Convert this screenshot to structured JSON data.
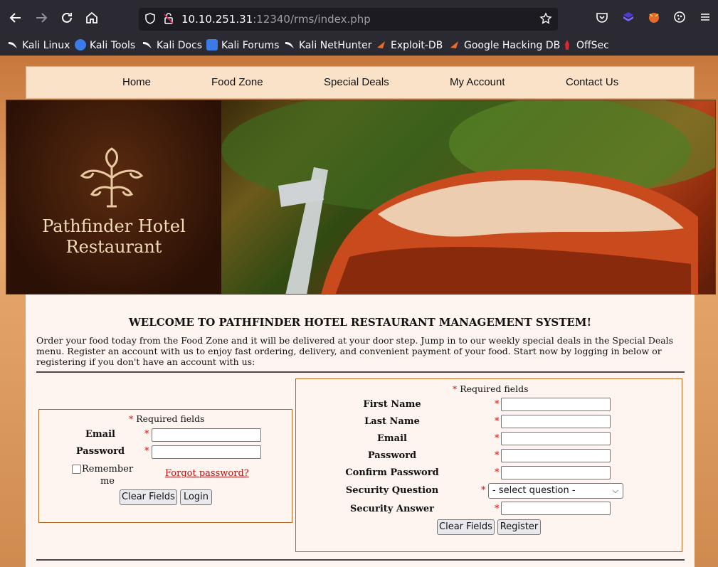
{
  "browser": {
    "url_host": "10.10.251.31",
    "url_rest": ":12340/rms/index.php",
    "icons": [
      "back-icon",
      "forward-icon",
      "reload-icon",
      "home-icon",
      "shield-icon",
      "lock-icon",
      "star-icon",
      "pocket-icon",
      "extension-icon",
      "profile-icon",
      "menu-icon"
    ],
    "bookmarks": [
      "Kali Linux",
      "Kali Tools",
      "Kali Docs",
      "Kali Forums",
      "Kali NetHunter",
      "Exploit-DB",
      "Google Hacking DB",
      "OffSec"
    ]
  },
  "menu": [
    "Home",
    "Food Zone",
    "Special Deals",
    "My Account",
    "Contact Us"
  ],
  "banner": {
    "name_line1": "Pathfinder Hotel",
    "name_line2": "Restaurant"
  },
  "main": {
    "welcome": "WELCOME TO PATHFINDER HOTEL RESTAURANT MANAGEMENT SYSTEM!",
    "intro": "Order your food today from the Food Zone and it will be delivered at your door step. Jump in to our weekly special deals in the Special Deals menu. Register an account with us to enjoy fast ordering, delivery, and convenient payment of your food. Start now by logging in below or registering if you don't have an account with us:"
  },
  "login": {
    "required": "Required fields",
    "email_label": "Email",
    "password_label": "Password",
    "remember_label": "Remember me",
    "forgot_label": "Forgot password?",
    "clear_label": "Clear Fields",
    "login_label": "Login"
  },
  "register": {
    "required": "Required fields",
    "first_name_label": "First Name",
    "last_name_label": "Last Name",
    "email_label": "Email",
    "password_label": "Password",
    "confirm_label": "Confirm Password",
    "question_label": "Security Question",
    "question_value": "- select question -",
    "answer_label": "Security Answer",
    "clear_label": "Clear Fields",
    "register_label": "Register"
  },
  "colors": {
    "page_bg": "#d08a4f",
    "menu_bg": "#fae2c8",
    "content_bg": "#fff5f0",
    "box_border": "#b5651d",
    "required_star": "#d01010"
  }
}
